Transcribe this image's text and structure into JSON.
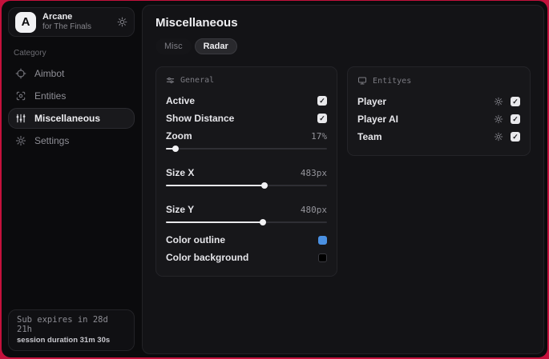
{
  "brand": {
    "logo_letter": "A",
    "name": "Arcane",
    "subtitle": "for The Finals"
  },
  "sidebar": {
    "category_label": "Category",
    "items": [
      {
        "label": "Aimbot",
        "icon": "crosshair-icon",
        "active": false
      },
      {
        "label": "Entities",
        "icon": "scan-icon",
        "active": false
      },
      {
        "label": "Miscellaneous",
        "icon": "sliders-icon",
        "active": true
      },
      {
        "label": "Settings",
        "icon": "gear-icon",
        "active": false
      }
    ],
    "subscription": {
      "expires_text": "Sub expires in 28d 21h",
      "session_text": "session duration 31m 30s"
    }
  },
  "main": {
    "title": "Miscellaneous",
    "tabs": [
      {
        "label": "Misc"
      },
      {
        "label": "Radar"
      }
    ],
    "active_tab": "Radar",
    "general": {
      "title": "General",
      "active_label": "Active",
      "active_checked": true,
      "show_distance_label": "Show Distance",
      "show_distance_checked": true,
      "zoom_label": "Zoom",
      "zoom_value": "17%",
      "size_x_label": "Size X",
      "size_x_value": "483px",
      "size_y_label": "Size Y",
      "size_y_value": "480px",
      "color_outline_label": "Color outline",
      "color_outline_value": "#4a90e2",
      "color_background_label": "Color background",
      "color_background_value": "#000000"
    },
    "entities": {
      "title": "Entityes",
      "rows": [
        {
          "label": "Player",
          "checked": true
        },
        {
          "label": "Player AI",
          "checked": true
        },
        {
          "label": "Team",
          "checked": true
        }
      ]
    }
  },
  "colors": {
    "backdrop_red": "#c4113c",
    "outline_blue": "#4a90e2",
    "background_swatch": "#000000",
    "checkbox_bg": "#e9e9ec"
  }
}
